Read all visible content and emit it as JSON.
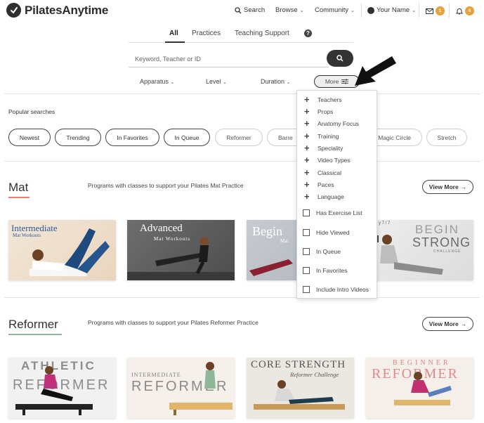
{
  "header": {
    "logo_text": "PilatesAnytime",
    "search_label": "Search",
    "browse_label": "Browse",
    "community_label": "Community",
    "user_label": "Your Name",
    "mail_badge": "1",
    "notif_badge": "6"
  },
  "tabs": [
    {
      "label": "All"
    },
    {
      "label": "Practices"
    },
    {
      "label": "Teaching Support"
    }
  ],
  "search": {
    "placeholder": "Keyword, Teacher or ID"
  },
  "filters": {
    "apparatus": "Apparatus",
    "level": "Level",
    "duration": "Duration",
    "more": "More"
  },
  "popular": {
    "label": "Popular searches",
    "chips": [
      "Newest",
      "Trending",
      "In Favorites",
      "In Queue",
      "Reformer",
      "Barre",
      "Magic Circle",
      "Stretch"
    ]
  },
  "dropdown": {
    "plus_items": [
      "Teachers",
      "Props",
      "Anatomy Focus",
      "Training",
      "Speciality",
      "Video Types",
      "Classical",
      "Paces",
      "Language"
    ],
    "check_items": [
      "Has Exercise List",
      "Hide Viewed",
      "In Queue",
      "In Favorites",
      "Include Intro Videos"
    ]
  },
  "mat": {
    "title": "Mat",
    "desc": "Programs with classes to support your Pilates Mat Practice",
    "view_more": "View More",
    "cards": [
      {
        "line1": "Intermediate",
        "line2": "Mat Workouts"
      },
      {
        "line1": "Advanced",
        "line2": "Mat Workouts"
      },
      {
        "line1": "Begin",
        "line2": "Mat"
      },
      {
        "line1": "BEGIN",
        "line2": "STRONG",
        "line3": "CHALLENGE",
        "corner": "y 7 / 7"
      }
    ]
  },
  "reformer": {
    "title": "Reformer",
    "desc": "Programs with classes to support your Pilates Reformer Practice",
    "view_more": "View More",
    "cards": [
      {
        "line1": "ATHLETIC",
        "line2": "REFORMER"
      },
      {
        "line1": "INTERMEDIATE",
        "line2": "REFORMER"
      },
      {
        "line1": "CORE STRENGTH",
        "line2": "Reformer Challenge"
      },
      {
        "line1": "BEGINNER",
        "line2": "REFORMER"
      }
    ]
  },
  "colors": {
    "mat_accent": "#e8806a",
    "reformer_accent": "#8fb89a",
    "badge": "#e8a23b"
  }
}
